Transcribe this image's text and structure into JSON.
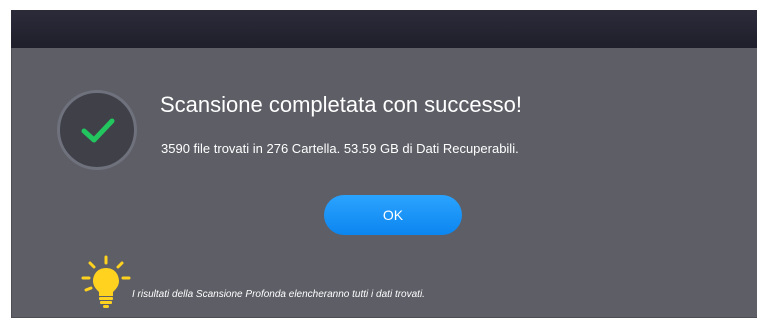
{
  "dialog": {
    "title": "Scansione completata con successo!",
    "summary": "3590 file trovati in 276 Cartella. 53.59 GB di Dati Recuperabili.",
    "ok_label": "OK",
    "tip_text": "I risultati della Scansione Profonda elencheranno tutti i dati trovati.",
    "status_icon": "checkmark-icon",
    "tip_icon": "lightbulb-icon"
  },
  "colors": {
    "dialog_bg": "#5d5e66",
    "titlebar_bg": "#24242f",
    "accent_blue": "#1a95f8",
    "check_green": "#22c55e",
    "bulb_yellow": "#ffd21f"
  }
}
